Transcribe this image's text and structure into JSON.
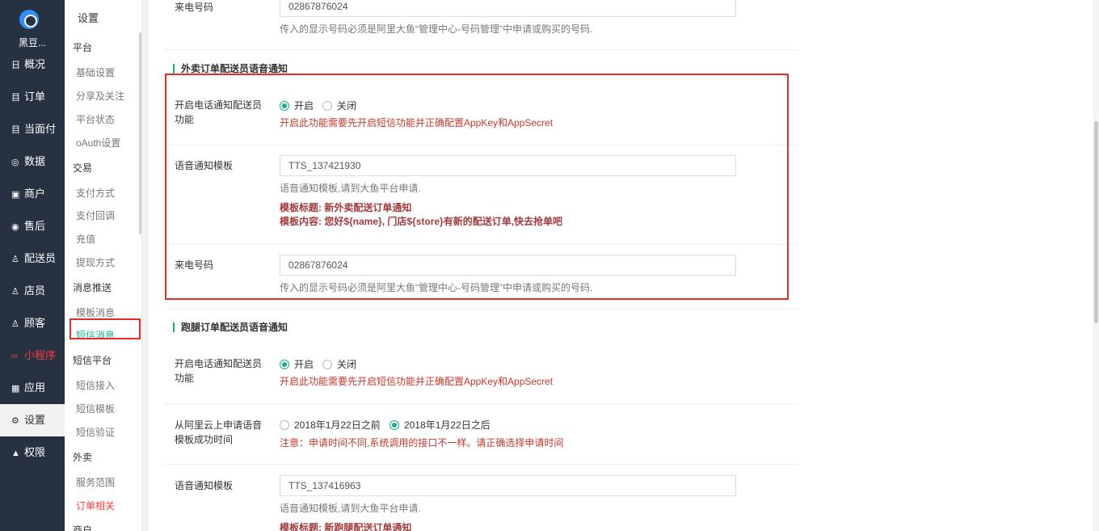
{
  "brand": "黑豆...",
  "nav": [
    {
      "icon": "日",
      "label": "概况",
      "name": "overview"
    },
    {
      "icon": "目",
      "label": "订单",
      "name": "orders"
    },
    {
      "icon": "目",
      "label": "当面付",
      "name": "face-pay"
    },
    {
      "icon": "◎",
      "label": "数据",
      "name": "data"
    },
    {
      "icon": "▣",
      "label": "商户",
      "name": "merchant"
    },
    {
      "icon": "◉",
      "label": "售后",
      "name": "after-sales"
    },
    {
      "icon": "♙",
      "label": "配送员",
      "name": "courier"
    },
    {
      "icon": "♙",
      "label": "店员",
      "name": "clerk"
    },
    {
      "icon": "♙",
      "label": "顾客",
      "name": "customer"
    },
    {
      "icon": "∞",
      "label": "小程序",
      "name": "mini-program"
    },
    {
      "icon": "▦",
      "label": "应用",
      "name": "apps"
    },
    {
      "icon": "⚙",
      "label": "设置",
      "name": "settings"
    },
    {
      "icon": "▲",
      "label": "权限",
      "name": "permissions"
    }
  ],
  "sub": {
    "title": "设置",
    "groups": {
      "platform": "平台",
      "trade": "交易",
      "msg": "消息推送",
      "sms": "短信平台",
      "takeout": "外卖",
      "merchant": "商户"
    },
    "items": {
      "basic": "基础设置",
      "share": "分享及关注",
      "status": "平台状态",
      "oauth": "oAuth设置",
      "paymethod": "支付方式",
      "paycallback": "支付回调",
      "recharge": "充值",
      "withdraw": "提现方式",
      "tplmsg": "模板消息",
      "smsmsg": "短信消息",
      "smsin": "短信接入",
      "smstpl": "短信模板",
      "smsverify": "短信验证",
      "range": "服务范围",
      "orderrel": "订单相关"
    }
  },
  "top": {
    "label": "来电号码",
    "value": "02867876024",
    "help": "传入的显示号码必须是阿里大鱼“管理中心-号码管理”中申请或购买的号码."
  },
  "sec1": {
    "title": "外卖订单配送员语音通知",
    "enable_label": "开启电话通知配送员功能",
    "radio_on": "开启",
    "radio_off": "关闭",
    "enable_help": "开启此功能需要先开启短信功能并正确配置AppKey和AppSecret",
    "tpl_label": "语音通知模板",
    "tpl_value": "TTS_137421930",
    "tpl_help": "语音通知模板,请到大鱼平台申请.",
    "tpl_title": "模板标题: 新外卖配送订单通知",
    "tpl_content": "模板内容: 您好${name}, 门店${store}有新的配送订单,快去抢单吧",
    "phone_label": "来电号码",
    "phone_value": "02867876024",
    "phone_help": "传入的显示号码必须是阿里大鱼“管理中心-号码管理”中申请或购买的号码."
  },
  "sec2": {
    "title": "跑腿订单配送员语音通知",
    "enable_label": "开启电话通知配送员功能",
    "radio_on": "开启",
    "radio_off": "关闭",
    "enable_help": "开启此功能需要先开启短信功能并正确配置AppKey和AppSecret",
    "time_label": "从阿里云上申请语音模板成功时间",
    "time_before": "2018年1月22日之前",
    "time_after": "2018年1月22日之后",
    "time_help": "注意：申请时间不同,系统调用的接口不一样。请正确选择申请时间",
    "tpl_label": "语音通知模板",
    "tpl_value": "TTS_137416963",
    "tpl_help": "语音通知模板,请到大鱼平台申请.",
    "tpl_title": "模板标题: 新跑腿配送订单通知"
  }
}
